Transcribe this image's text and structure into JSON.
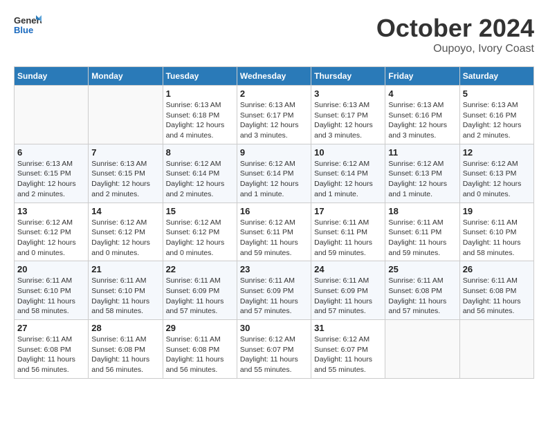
{
  "header": {
    "logo_general": "General",
    "logo_blue": "Blue",
    "title": "October 2024",
    "subtitle": "Oupoyo, Ivory Coast"
  },
  "weekdays": [
    "Sunday",
    "Monday",
    "Tuesday",
    "Wednesday",
    "Thursday",
    "Friday",
    "Saturday"
  ],
  "weeks": [
    [
      {
        "day": "",
        "detail": ""
      },
      {
        "day": "",
        "detail": ""
      },
      {
        "day": "1",
        "detail": "Sunrise: 6:13 AM\nSunset: 6:18 PM\nDaylight: 12 hours and 4 minutes."
      },
      {
        "day": "2",
        "detail": "Sunrise: 6:13 AM\nSunset: 6:17 PM\nDaylight: 12 hours and 3 minutes."
      },
      {
        "day": "3",
        "detail": "Sunrise: 6:13 AM\nSunset: 6:17 PM\nDaylight: 12 hours and 3 minutes."
      },
      {
        "day": "4",
        "detail": "Sunrise: 6:13 AM\nSunset: 6:16 PM\nDaylight: 12 hours and 3 minutes."
      },
      {
        "day": "5",
        "detail": "Sunrise: 6:13 AM\nSunset: 6:16 PM\nDaylight: 12 hours and 2 minutes."
      }
    ],
    [
      {
        "day": "6",
        "detail": "Sunrise: 6:13 AM\nSunset: 6:15 PM\nDaylight: 12 hours and 2 minutes."
      },
      {
        "day": "7",
        "detail": "Sunrise: 6:13 AM\nSunset: 6:15 PM\nDaylight: 12 hours and 2 minutes."
      },
      {
        "day": "8",
        "detail": "Sunrise: 6:12 AM\nSunset: 6:14 PM\nDaylight: 12 hours and 2 minutes."
      },
      {
        "day": "9",
        "detail": "Sunrise: 6:12 AM\nSunset: 6:14 PM\nDaylight: 12 hours and 1 minute."
      },
      {
        "day": "10",
        "detail": "Sunrise: 6:12 AM\nSunset: 6:14 PM\nDaylight: 12 hours and 1 minute."
      },
      {
        "day": "11",
        "detail": "Sunrise: 6:12 AM\nSunset: 6:13 PM\nDaylight: 12 hours and 1 minute."
      },
      {
        "day": "12",
        "detail": "Sunrise: 6:12 AM\nSunset: 6:13 PM\nDaylight: 12 hours and 0 minutes."
      }
    ],
    [
      {
        "day": "13",
        "detail": "Sunrise: 6:12 AM\nSunset: 6:12 PM\nDaylight: 12 hours and 0 minutes."
      },
      {
        "day": "14",
        "detail": "Sunrise: 6:12 AM\nSunset: 6:12 PM\nDaylight: 12 hours and 0 minutes."
      },
      {
        "day": "15",
        "detail": "Sunrise: 6:12 AM\nSunset: 6:12 PM\nDaylight: 12 hours and 0 minutes."
      },
      {
        "day": "16",
        "detail": "Sunrise: 6:12 AM\nSunset: 6:11 PM\nDaylight: 11 hours and 59 minutes."
      },
      {
        "day": "17",
        "detail": "Sunrise: 6:11 AM\nSunset: 6:11 PM\nDaylight: 11 hours and 59 minutes."
      },
      {
        "day": "18",
        "detail": "Sunrise: 6:11 AM\nSunset: 6:11 PM\nDaylight: 11 hours and 59 minutes."
      },
      {
        "day": "19",
        "detail": "Sunrise: 6:11 AM\nSunset: 6:10 PM\nDaylight: 11 hours and 58 minutes."
      }
    ],
    [
      {
        "day": "20",
        "detail": "Sunrise: 6:11 AM\nSunset: 6:10 PM\nDaylight: 11 hours and 58 minutes."
      },
      {
        "day": "21",
        "detail": "Sunrise: 6:11 AM\nSunset: 6:10 PM\nDaylight: 11 hours and 58 minutes."
      },
      {
        "day": "22",
        "detail": "Sunrise: 6:11 AM\nSunset: 6:09 PM\nDaylight: 11 hours and 57 minutes."
      },
      {
        "day": "23",
        "detail": "Sunrise: 6:11 AM\nSunset: 6:09 PM\nDaylight: 11 hours and 57 minutes."
      },
      {
        "day": "24",
        "detail": "Sunrise: 6:11 AM\nSunset: 6:09 PM\nDaylight: 11 hours and 57 minutes."
      },
      {
        "day": "25",
        "detail": "Sunrise: 6:11 AM\nSunset: 6:08 PM\nDaylight: 11 hours and 57 minutes."
      },
      {
        "day": "26",
        "detail": "Sunrise: 6:11 AM\nSunset: 6:08 PM\nDaylight: 11 hours and 56 minutes."
      }
    ],
    [
      {
        "day": "27",
        "detail": "Sunrise: 6:11 AM\nSunset: 6:08 PM\nDaylight: 11 hours and 56 minutes."
      },
      {
        "day": "28",
        "detail": "Sunrise: 6:11 AM\nSunset: 6:08 PM\nDaylight: 11 hours and 56 minutes."
      },
      {
        "day": "29",
        "detail": "Sunrise: 6:11 AM\nSunset: 6:08 PM\nDaylight: 11 hours and 56 minutes."
      },
      {
        "day": "30",
        "detail": "Sunrise: 6:12 AM\nSunset: 6:07 PM\nDaylight: 11 hours and 55 minutes."
      },
      {
        "day": "31",
        "detail": "Sunrise: 6:12 AM\nSunset: 6:07 PM\nDaylight: 11 hours and 55 minutes."
      },
      {
        "day": "",
        "detail": ""
      },
      {
        "day": "",
        "detail": ""
      }
    ]
  ]
}
